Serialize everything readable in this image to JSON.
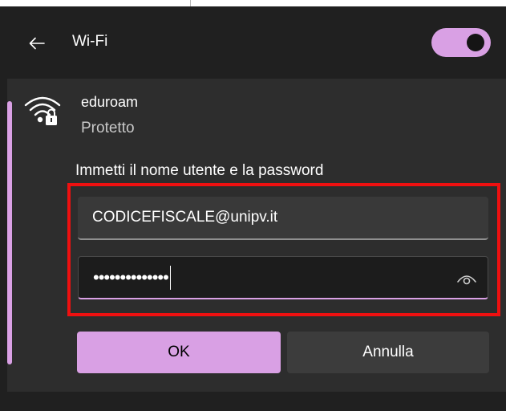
{
  "header": {
    "back_icon": "arrow-left-icon",
    "title": "Wi-Fi",
    "toggle_on": true
  },
  "network": {
    "icon": "wifi-secured-icon",
    "name": "eduroam",
    "status": "Protetto",
    "prompt": "Immetti il nome utente e la password",
    "username": "CODICEFISCALE@unipv.it",
    "password_mask": "••••••••••••••",
    "reveal_icon": "eye-icon",
    "ok_label": "OK",
    "cancel_label": "Annulla"
  },
  "colors": {
    "accent": "#d9a0e4",
    "highlight": "#ef1010",
    "panel_bg": "#202020",
    "card_bg": "#2d2d2d"
  }
}
